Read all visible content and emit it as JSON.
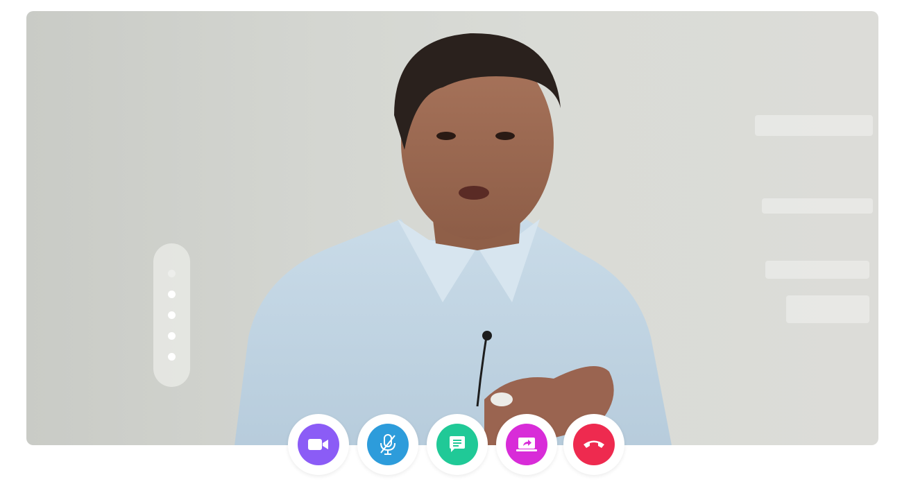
{
  "video": {
    "participant": "presenter"
  },
  "pagination": {
    "count": 5,
    "active_index": 0
  },
  "controls": [
    {
      "name": "camera-button",
      "icon": "video-camera-icon",
      "color": "#8b5cf6"
    },
    {
      "name": "microphone-button",
      "icon": "microphone-off-icon",
      "color": "#2d9cdb"
    },
    {
      "name": "chat-button",
      "icon": "chat-icon",
      "color": "#20c997"
    },
    {
      "name": "screen-share-button",
      "icon": "screen-share-icon",
      "color": "#d82cd8"
    },
    {
      "name": "end-call-button",
      "icon": "phone-hangup-icon",
      "color": "#ee2a4f"
    }
  ]
}
